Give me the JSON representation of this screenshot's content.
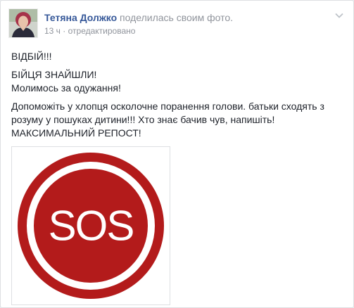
{
  "post": {
    "author_name": "Тетяна Должко",
    "action_text": "поделилась своим фото.",
    "timestamp": "13 ч",
    "separator": "·",
    "edited_label": "отредактировано",
    "paragraphs": [
      [
        "ВІДБІЙ!!!"
      ],
      [
        "БІЙЦЯ ЗНАЙШЛИ!",
        "Молимось за одужання!"
      ],
      [
        "Допоможіть у хлопця осколочне поранення голови. батьки сходять з розуму у пошуках дитини!!! Хто знає бачив чув, напишіть!",
        "МАКСИМАЛЬНИЙ РЕПОСТ!"
      ]
    ],
    "photo": {
      "text": "SOS",
      "color": "#b31b1b"
    }
  },
  "icons": {
    "menu": "chevron-down-icon"
  },
  "colors": {
    "link": "#365899",
    "muted": "#90949c",
    "text": "#1d2129",
    "sos_red": "#b31b1b"
  }
}
